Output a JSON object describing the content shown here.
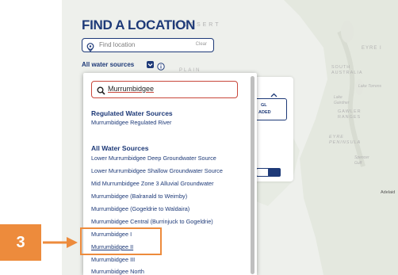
{
  "header": {
    "title": "FIND A LOCATION"
  },
  "search": {
    "placeholder": "Find location",
    "clear_label": "Clear"
  },
  "filter": {
    "label": "All water sources"
  },
  "map_labels": {
    "desert": "A DESERT",
    "south_australia": "SOUTH AUSTRALIA",
    "eyre": "EYRE I",
    "lake_torrens": "Lake Torrens",
    "lake_gairdner": "Lake Gairdner",
    "gawler": "GAWLER RANGES",
    "eyre_peninsula": "EYRE PENINSULA",
    "spencer_gulf": "Spencer Gulf",
    "adelaide": "Adelaid",
    "plain": "PLAIN"
  },
  "card": {
    "gl_line1": "GL",
    "gl_line2": "ADED"
  },
  "dropdown": {
    "query": "Murrumbidgee",
    "regulated_heading": "Regulated Water Sources",
    "regulated_items": [
      "Murrumbidgee Regulated River"
    ],
    "all_heading": "All Water Sources",
    "all_items": [
      "Lower Murrumbidgee Deep Groundwater Source",
      "Lower Murrumbidgee Shallow Groundwater Source",
      "Mid Murrumbidgee Zone 3 Alluvial Groundwater",
      "Murrumbidgee (Balranald to Weimby)",
      "Murrumbidgee (Gogeldrie to Waldaira)",
      "Murrumbidgee Central (Burrinjuck to Gogeldrie)",
      "Murrumbidgee I",
      "Murrumbidgee II",
      "Murrumbidgee III",
      "Murrumbidgee North"
    ]
  },
  "callout": {
    "number": "3"
  },
  "colors": {
    "brand_navy": "#1e3a78",
    "callout_orange": "#ed8b3c",
    "search_red": "#c8473b"
  }
}
